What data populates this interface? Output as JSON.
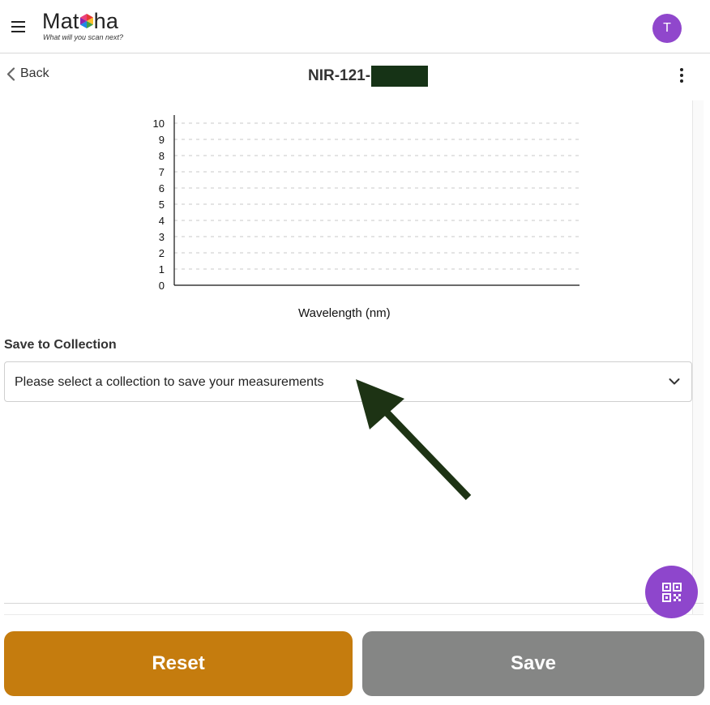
{
  "app": {
    "logo_text_left": "Mat",
    "logo_text_right": "ha",
    "tagline": "What will you scan next?",
    "avatar_initial": "T"
  },
  "header": {
    "back_label": "Back",
    "title": "NIR-121-"
  },
  "chart_data": {
    "type": "line",
    "title": "",
    "xlabel": "Wavelength (nm)",
    "ylabel": "",
    "ylim": [
      0,
      10
    ],
    "y_ticks": [
      "0",
      "1",
      "2",
      "3",
      "4",
      "5",
      "6",
      "7",
      "8",
      "9",
      "10"
    ],
    "grid": "horizontal dashed",
    "series": []
  },
  "collection": {
    "label": "Save to Collection",
    "placeholder": "Please select a collection to save your measurements"
  },
  "actions": {
    "reset_label": "Reset",
    "save_label": "Save"
  },
  "colors": {
    "accent_purple": "#8e46cc",
    "reset_orange": "#c57c0e",
    "save_gray": "#858685",
    "annotation_arrow": "#1d3314"
  }
}
